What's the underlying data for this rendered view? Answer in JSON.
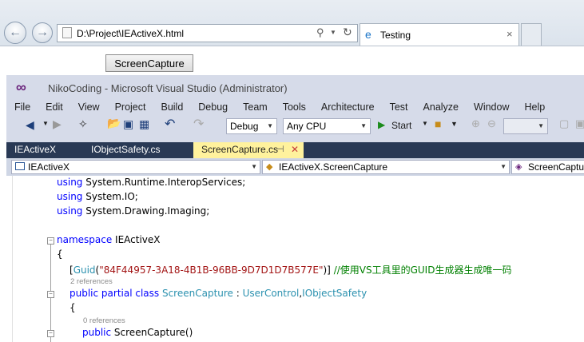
{
  "browser": {
    "back_icon": "arrow-left-icon",
    "forward_icon": "arrow-right-icon",
    "address": "D:\\Project\\IEActiveX.html",
    "tab_title": "Testing",
    "tab_close": "×"
  },
  "page": {
    "button_label": "ScreenCapture"
  },
  "vs": {
    "title": "NikoCoding - Microsoft Visual Studio (Administrator)",
    "menu": [
      "File",
      "Edit",
      "View",
      "Project",
      "Build",
      "Debug",
      "Team",
      "Tools",
      "Architecture",
      "Test",
      "Analyze",
      "Window",
      "Help"
    ],
    "toolbar": {
      "config": "Debug",
      "platform": "Any CPU",
      "start": "Start"
    },
    "tabs": [
      {
        "label": "IEActiveX"
      },
      {
        "label": "IObjectSafety.cs"
      },
      {
        "label": "ScreenCapture.cs",
        "pin": "⊣",
        "close": "✕"
      }
    ],
    "navbar": {
      "project": "IEActiveX",
      "type": "IEActiveX.ScreenCapture",
      "member": "ScreenCaptur"
    }
  },
  "code": {
    "using1_kw": "using",
    "using1_ns": " System.Runtime.InteropServices;",
    "using2_kw": "using",
    "using2_ns": " System.IO;",
    "using3_kw": "using",
    "using3_ns": " System.Drawing.Imaging;",
    "ns_kw": "namespace",
    "ns_name": " IEActiveX",
    "brace_open": "{",
    "attr_open": "[",
    "attr_name": "Guid",
    "attr_paren": "(",
    "attr_value": "\"84F44957-3A18-4B1B-96BB-9D7D1D7B577E\"",
    "attr_close": ")]",
    "attr_comment": " //使用VS工具里的GUID生成器生成唯一码",
    "refs_class": "2 references",
    "class_mod": "public partial class ",
    "class_name": "ScreenCapture",
    "class_sep": " : ",
    "class_base1": "UserControl",
    "class_comma": ",",
    "class_base2": "IObjectSafety",
    "class_brace": "{",
    "refs_ctor": "0 references",
    "ctor_kw": "public",
    "ctor_name": " ScreenCapture()"
  }
}
